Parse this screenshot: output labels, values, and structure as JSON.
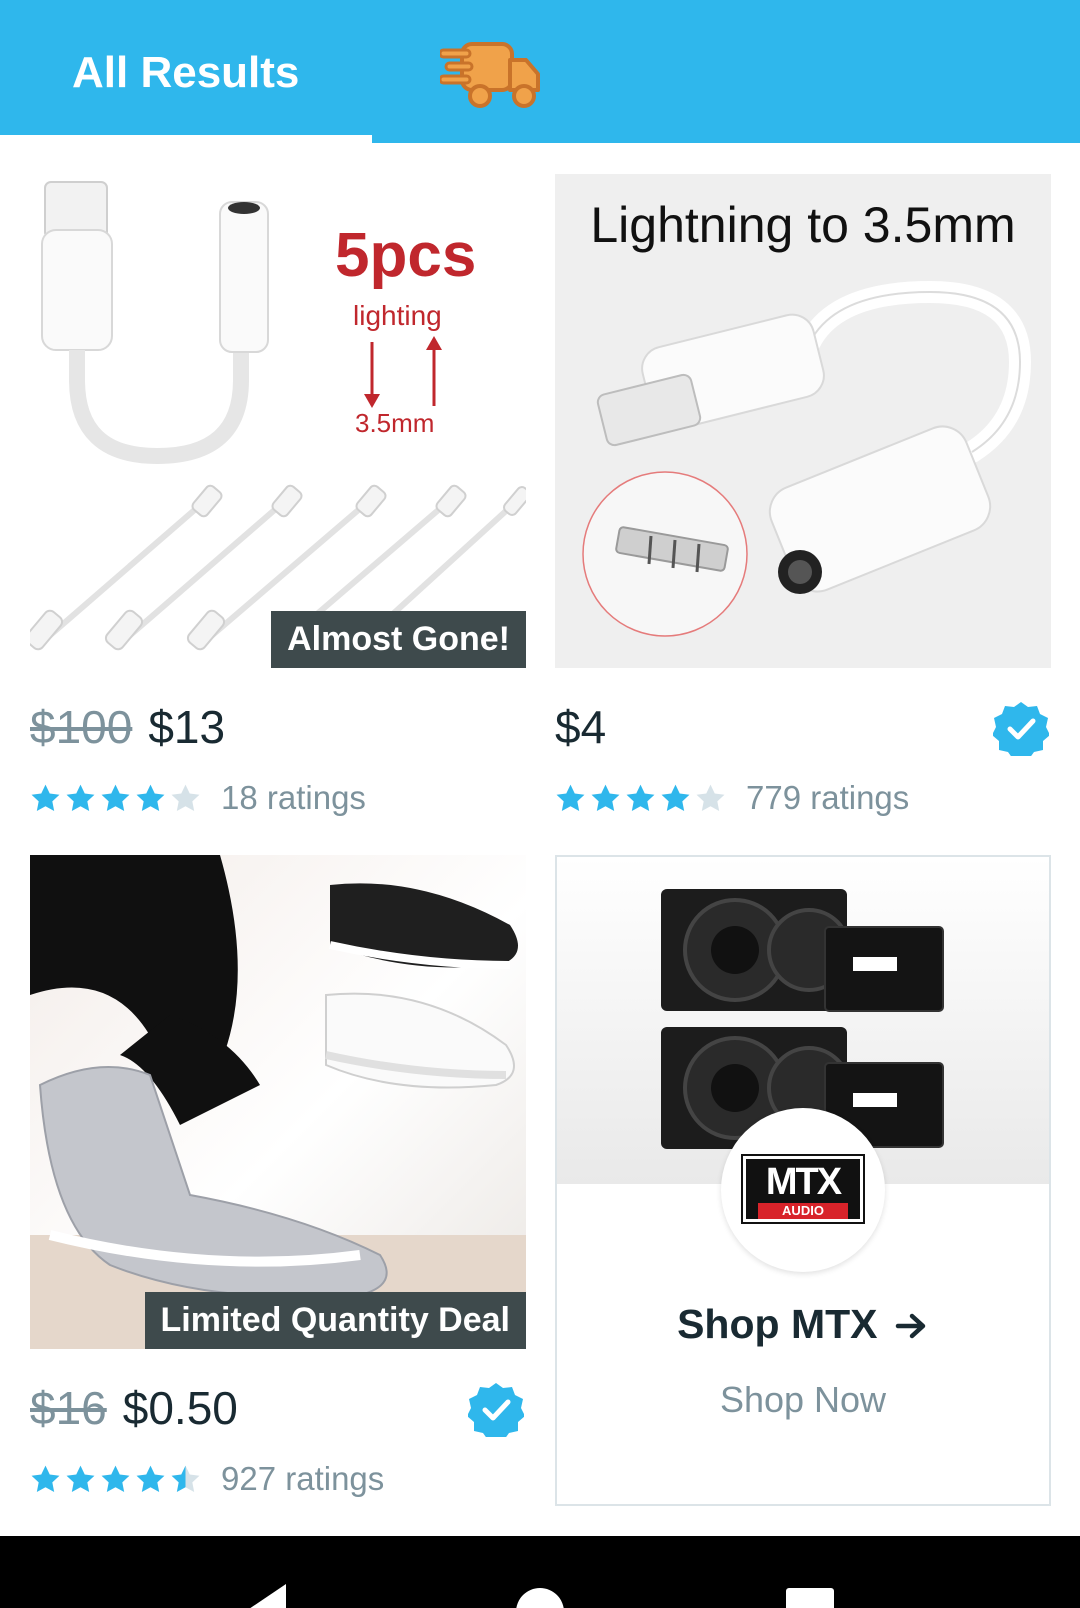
{
  "tabs": {
    "all_results": "All Results",
    "express_icon": "express-delivery-truck-icon"
  },
  "products": [
    {
      "image_title": "5pcs",
      "image_sub": "lighting",
      "image_sub2": "3.5mm",
      "badge": "Almost Gone!",
      "old_price": "$100",
      "price": "$13",
      "rating": 4,
      "rating_count": "18 ratings",
      "verified": false
    },
    {
      "image_title": "Lightning to 3.5mm",
      "old_price": "",
      "price": "$4",
      "rating": 4,
      "rating_count": "779 ratings",
      "verified": true
    },
    {
      "badge": "Limited Quantity Deal",
      "old_price": "$16",
      "price": "$0.50",
      "rating": 4.5,
      "rating_count": "927 ratings",
      "verified": true
    }
  ],
  "brand": {
    "logo_text": "MTX",
    "logo_sub": "AUDIO",
    "title": "Shop MTX",
    "cta": "Shop Now"
  },
  "colors": {
    "header": "#2fb7ec",
    "star": "#2fb7ec",
    "star_empty": "#d6e2e8",
    "badge_bg": "#3e4a4c",
    "muted_text": "#7d929c"
  }
}
